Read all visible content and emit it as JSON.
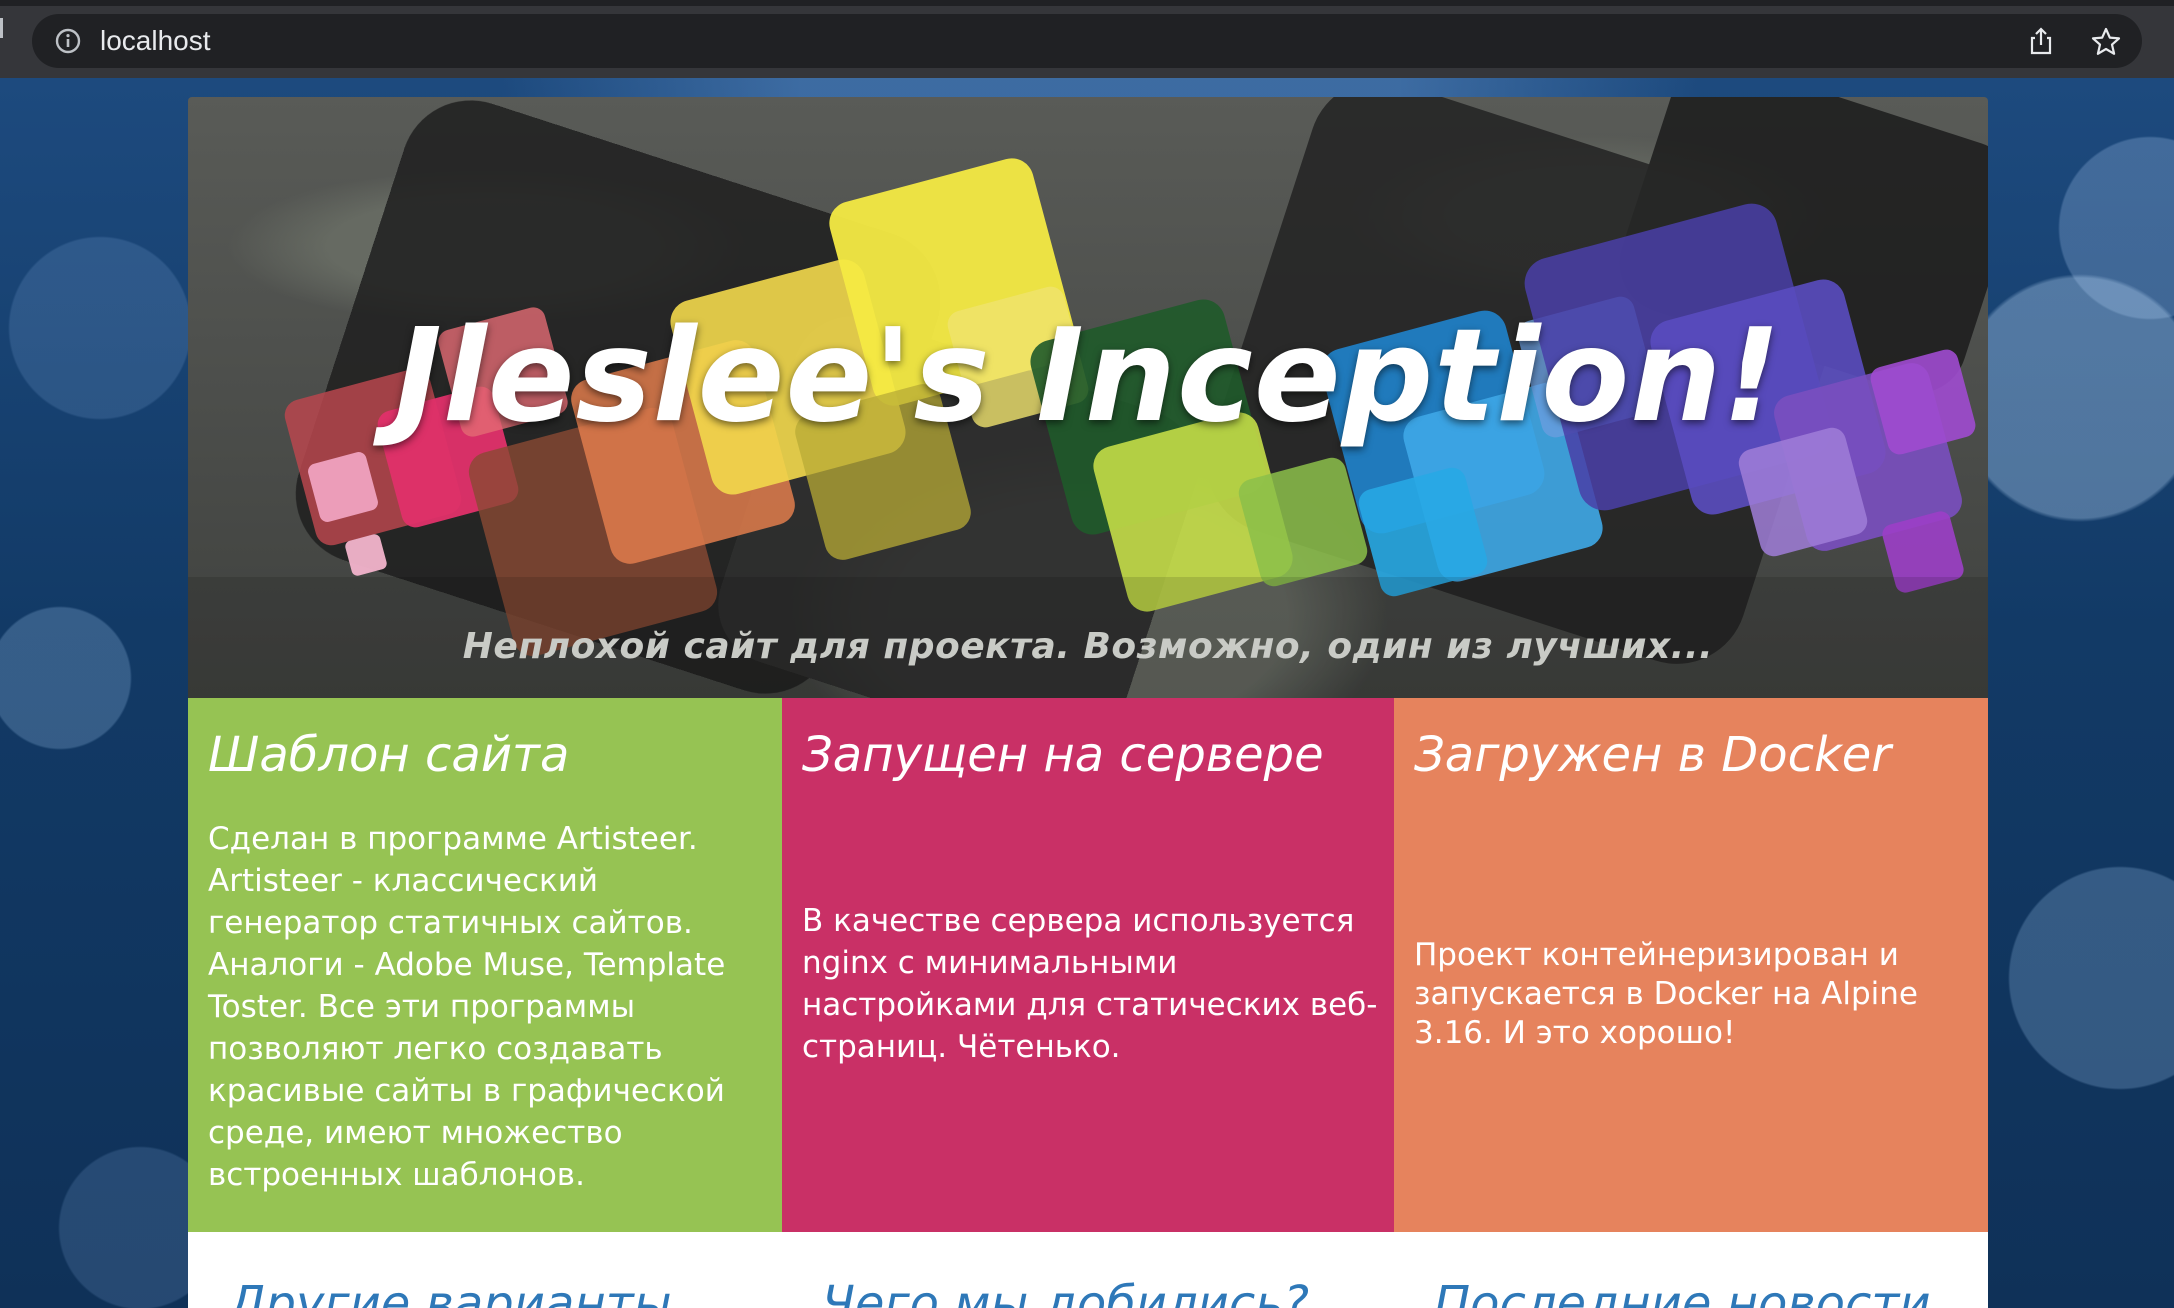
{
  "browser": {
    "url": "localhost"
  },
  "header": {
    "title": "Jleslee's Inception!",
    "slogan": "Неплохой сайт для проекта. Возможно, один из лучших..."
  },
  "columns": [
    {
      "heading": "Шаблон сайта",
      "text": "Сделан в программе Artisteer. Artisteer - классический генератор статичных сайтов. Аналоги - Adobe Muse, Template Toster. Все эти программы позволяют легко создавать красивые сайты в графической среде, имеют множество встроенных шаблонов.",
      "color": "#96c353"
    },
    {
      "heading": "Запущен на сервере",
      "text": "В качестве сервера используется nginx с минимальными настройками для статических веб-страниц. Чётенько.",
      "color": "#c93066"
    },
    {
      "heading": "Загружен в Docker",
      "text": "Проект контейнеризирован и запускается в Docker на Alpine 3.16. И это хорошо!",
      "color": "#e6835d"
    }
  ],
  "lower": {
    "headings": [
      "Другие варианты",
      "Чего мы добились?",
      "Последние новости"
    ],
    "color": "#2e78b8"
  },
  "icons": {
    "info": "info-icon",
    "share": "share-icon",
    "bookmark": "star-icon"
  }
}
